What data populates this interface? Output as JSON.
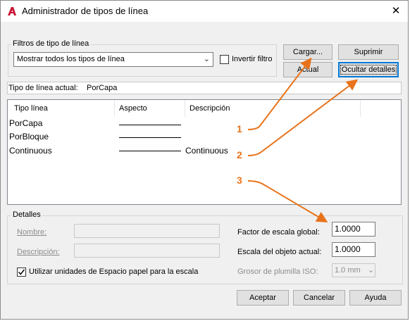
{
  "window": {
    "title": "Administrador de tipos de línea",
    "close_glyph": "✕",
    "app_icon": "autocad-a-icon",
    "accent_color": "#0078d7",
    "callout_color": "#e8731a"
  },
  "filters": {
    "group_label": "Filtros de tipo de línea",
    "selected": "Mostrar todos los tipos de línea",
    "invert_label": "Invertir filtro",
    "invert_checked": false
  },
  "buttons": {
    "load": "Cargar...",
    "delete": "Suprimir",
    "current": "Actual",
    "hide_details": "Ocultar detalles",
    "ok": "Aceptar",
    "cancel": "Cancelar",
    "help": "Ayuda"
  },
  "current_linetype": {
    "label": "Tipo de línea actual:",
    "value": "PorCapa"
  },
  "list": {
    "columns": [
      "Tipo línea",
      "Aspecto",
      "Descripción"
    ],
    "rows": [
      {
        "name": "PorCapa",
        "description": ""
      },
      {
        "name": "PorBloque",
        "description": ""
      },
      {
        "name": "Continuous",
        "description": "Continuous"
      }
    ]
  },
  "details": {
    "group_label": "Detalles",
    "name_label": "Nombre:",
    "description_label": "Descripción:",
    "paper_space_label": "Utilizar unidades de Espacio papel para la escala",
    "paper_space_checked": true,
    "global_scale_label": "Factor de escala global:",
    "global_scale_value": "1.0000",
    "object_scale_label": "Escala del objeto actual:",
    "object_scale_value": "1.0000",
    "pen_width_label": "Grosor de plumilla ISO:",
    "pen_width_value": "1.0 mm"
  },
  "callouts": [
    "1",
    "2",
    "3"
  ]
}
